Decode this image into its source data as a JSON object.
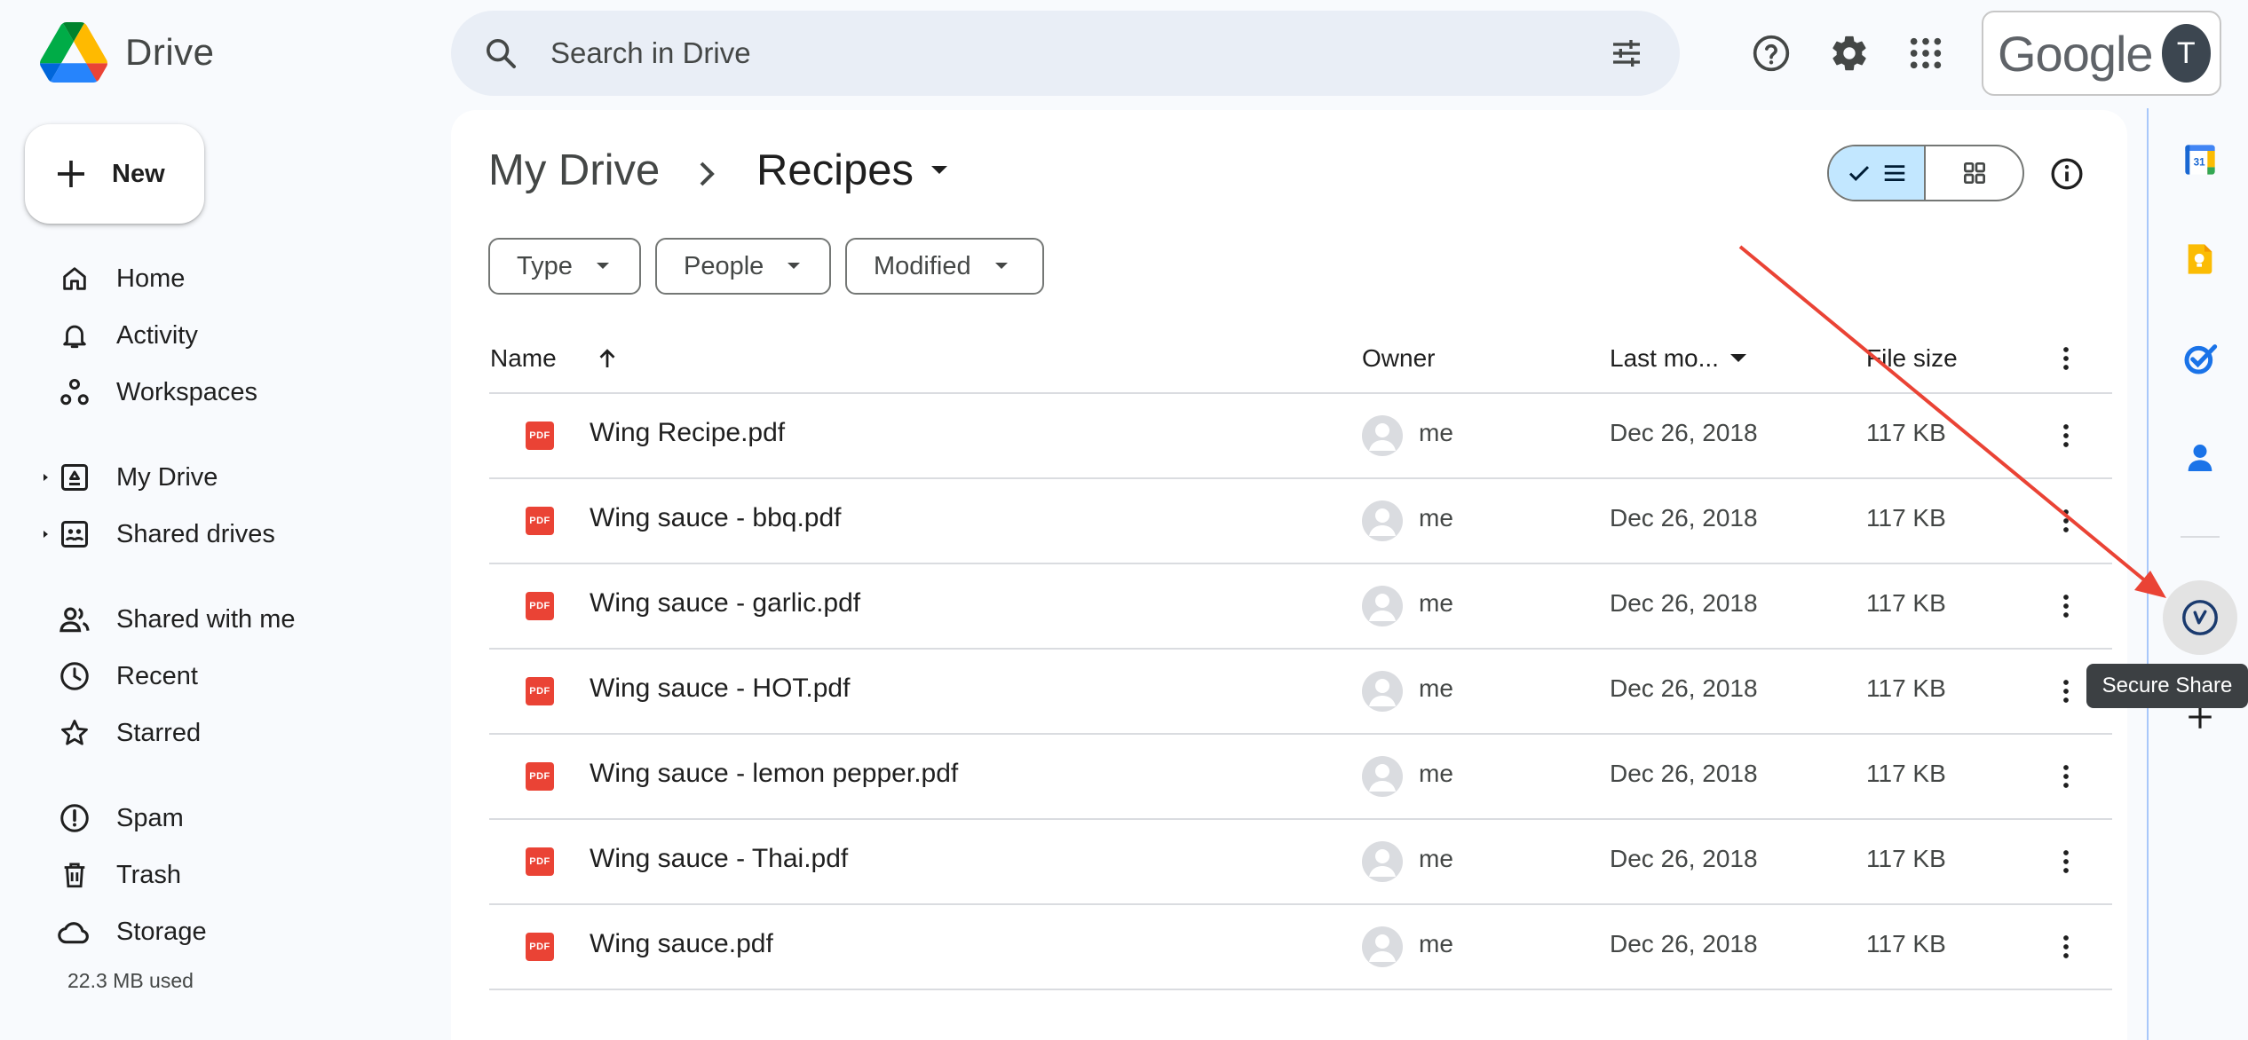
{
  "app": {
    "name": "Drive"
  },
  "search": {
    "placeholder": "Search in Drive"
  },
  "account": {
    "brand": "Google",
    "initial": "T"
  },
  "sidebar": {
    "new_label": "New",
    "items": [
      {
        "label": "Home",
        "icon": "home-icon"
      },
      {
        "label": "Activity",
        "icon": "bell-icon"
      },
      {
        "label": "Workspaces",
        "icon": "workspaces-icon"
      },
      {
        "label": "My Drive",
        "icon": "my-drive-icon"
      },
      {
        "label": "Shared drives",
        "icon": "shared-drives-icon"
      },
      {
        "label": "Shared with me",
        "icon": "people-icon"
      },
      {
        "label": "Recent",
        "icon": "clock-icon"
      },
      {
        "label": "Starred",
        "icon": "star-icon"
      },
      {
        "label": "Spam",
        "icon": "spam-icon"
      },
      {
        "label": "Trash",
        "icon": "trash-icon"
      },
      {
        "label": "Storage",
        "icon": "cloud-icon"
      }
    ],
    "storage_used": "22.3 MB used"
  },
  "breadcrumb": {
    "root": "My Drive",
    "current": "Recipes"
  },
  "filters": {
    "type": "Type",
    "people": "People",
    "modified": "Modified"
  },
  "table": {
    "headers": {
      "name": "Name",
      "owner": "Owner",
      "modified": "Last mo...",
      "size": "File size"
    },
    "rows": [
      {
        "name": "Wing Recipe.pdf",
        "owner": "me",
        "modified": "Dec 26, 2018",
        "size": "117 KB"
      },
      {
        "name": "Wing sauce - bbq.pdf",
        "owner": "me",
        "modified": "Dec 26, 2018",
        "size": "117 KB"
      },
      {
        "name": "Wing sauce - garlic.pdf",
        "owner": "me",
        "modified": "Dec 26, 2018",
        "size": "117 KB"
      },
      {
        "name": "Wing sauce - HOT.pdf",
        "owner": "me",
        "modified": "Dec 26, 2018",
        "size": "117 KB"
      },
      {
        "name": "Wing sauce - lemon pepper.pdf",
        "owner": "me",
        "modified": "Dec 26, 2018",
        "size": "117 KB"
      },
      {
        "name": "Wing sauce - Thai.pdf",
        "owner": "me",
        "modified": "Dec 26, 2018",
        "size": "117 KB"
      },
      {
        "name": "Wing sauce.pdf",
        "owner": "me",
        "modified": "Dec 26, 2018",
        "size": "117 KB"
      }
    ]
  },
  "rail": {
    "calendar_day": "31",
    "tooltip": "Secure Share"
  },
  "file_badge": "PDF",
  "colors": {
    "accent": "#0b57d0",
    "toggle_active": "#c2e7ff",
    "pdf_red": "#ea4335",
    "annotation_arrow": "#ea4335"
  }
}
